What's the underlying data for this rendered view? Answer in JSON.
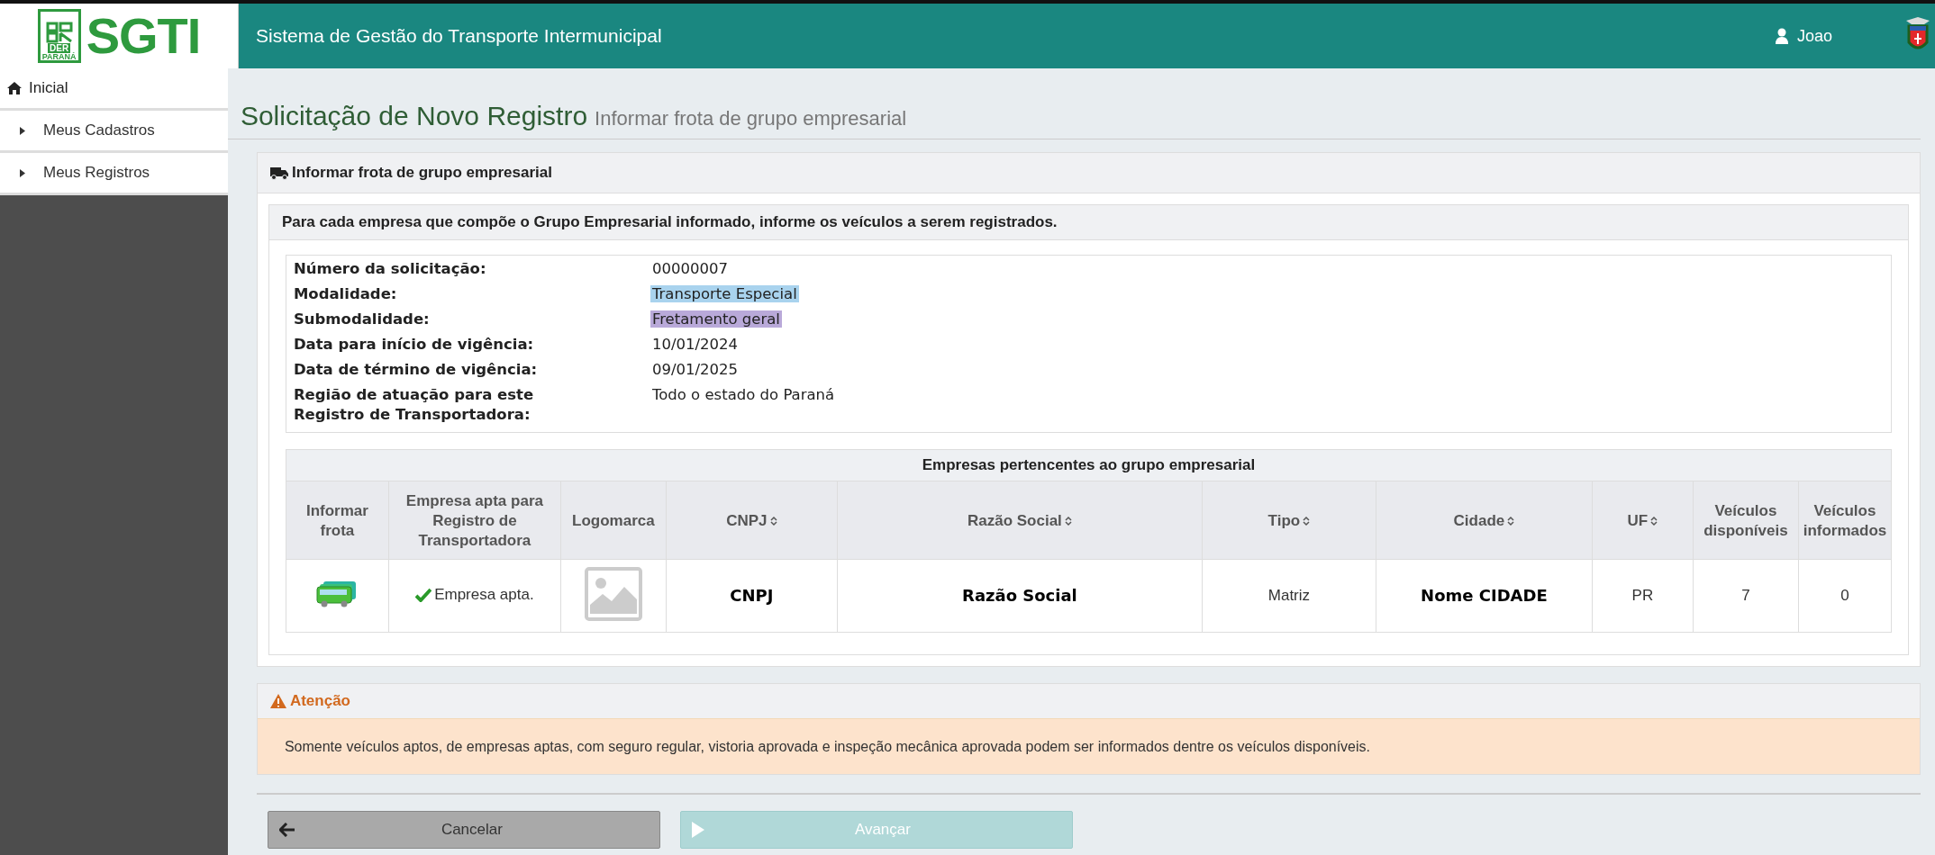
{
  "logo": {
    "mark": "DER",
    "sub": "PARANÁ",
    "name": "SGTI"
  },
  "header": {
    "title": "Sistema de Gestão do Transporte Intermunicipal",
    "user": "Joao"
  },
  "sidebar": {
    "items": [
      {
        "label": "Inicial",
        "kind": "home"
      },
      {
        "label": "Meus Cadastros",
        "kind": "submenu"
      },
      {
        "label": "Meus Registros",
        "kind": "submenu"
      }
    ]
  },
  "page": {
    "title": "Solicitação de Novo Registro",
    "subtitle": "Informar frota de grupo empresarial"
  },
  "panel": {
    "title": "Informar frota de grupo empresarial",
    "instruction": "Para cada empresa que compõe o Grupo Empresarial informado, informe os veículos a serem registrados.",
    "fields": [
      {
        "label": "Número da solicitação:",
        "value": "00000007"
      },
      {
        "label": "Modalidade:",
        "value": "Transporte Especial",
        "color": "#a9d3ee"
      },
      {
        "label": "Submodalidade:",
        "value": "Fretamento geral",
        "color": "#b9a9d9"
      },
      {
        "label": "Data para início de vigência:",
        "value": "10/01/2024"
      },
      {
        "label": "Data de término de vigência:",
        "value": "09/01/2025"
      },
      {
        "label": "Região de atuação para este Registro de Transportadora:",
        "value": "Todo o estado do Paraná"
      }
    ],
    "table": {
      "title": "Empresas pertencentes ao grupo empresarial",
      "columns": [
        {
          "label": "Informar frota",
          "sortable": false
        },
        {
          "label": "Empresa apta para Registro de Transportadora",
          "sortable": false
        },
        {
          "label": "Logomarca",
          "sortable": false
        },
        {
          "label": "CNPJ",
          "sortable": true
        },
        {
          "label": "Razão Social",
          "sortable": true
        },
        {
          "label": "Tipo",
          "sortable": true
        },
        {
          "label": "Cidade",
          "sortable": true
        },
        {
          "label": "UF",
          "sortable": true
        },
        {
          "label": "Veículos disponíveis",
          "sortable": false
        },
        {
          "label": "Veículos informados",
          "sortable": false
        }
      ],
      "rows": [
        {
          "cells": [
            {
              "kind": "bus"
            },
            {
              "kind": "apta",
              "text": "Empresa apta."
            },
            {
              "kind": "logo"
            },
            {
              "kind": "text",
              "text": "CNPJ",
              "bold": true
            },
            {
              "kind": "text",
              "text": "Razão Social",
              "bold": true
            },
            {
              "kind": "text",
              "text": "Matriz",
              "bold": false
            },
            {
              "kind": "text",
              "text": "Nome CIDADE",
              "bold": true
            },
            {
              "kind": "text",
              "text": "PR",
              "bold": false
            },
            {
              "kind": "text",
              "text": "7",
              "bold": false
            },
            {
              "kind": "text",
              "text": "0",
              "bold": false
            }
          ]
        }
      ]
    }
  },
  "alert": {
    "title": "Atenção",
    "message": "Somente veículos aptos, de empresas aptas, com seguro regular, vistoria aprovada e inspeção mecânica aprovada podem ser informados dentre os veículos disponíveis."
  },
  "buttons": [
    {
      "label": "Cancelar",
      "kind": "back",
      "disabled": false
    },
    {
      "label": "Avançar",
      "kind": "next",
      "disabled": true
    }
  ]
}
